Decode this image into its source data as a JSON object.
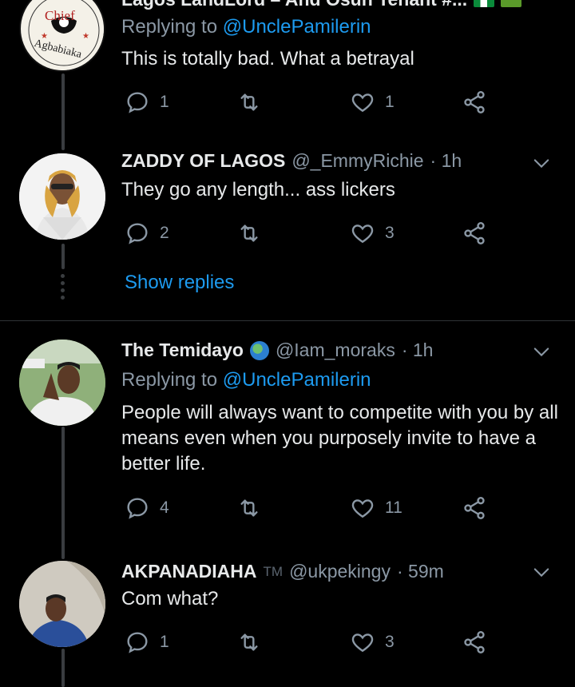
{
  "tweets": [
    {
      "name": "Lagos LandLord – And Osun Tenant #...",
      "reply_prefix": "Replying to ",
      "reply_handle": "@UnclePamilerin",
      "text": "This is totally bad. What a betrayal",
      "replies": "1",
      "likes": "1",
      "avatar_badge": {
        "line1": "Chief",
        "line2": "Agbabiaka"
      }
    },
    {
      "name": "ZADDY OF LAGOS",
      "handle": "@_EmmyRichie",
      "time": "· 1h",
      "text": "They go any length...  ass lickers",
      "replies": "2",
      "likes": "3"
    },
    {
      "name": "The Temidayo",
      "handle": "@Iam_moraks",
      "time": "· 1h",
      "reply_prefix": "Replying to ",
      "reply_handle": "@UnclePamilerin",
      "text": "People will always want to competite with you by all means even when you purposely invite to have a better life.",
      "replies": "4",
      "likes": "11"
    },
    {
      "name": "AKPANADIAHA",
      "tm": "TM",
      "handle": "@ukpekingy",
      "time": "· 59m",
      "text": "Com what?",
      "replies": "1",
      "likes": "3"
    }
  ],
  "show_replies": "Show replies",
  "icons": [
    "reply-icon",
    "retweet-icon",
    "like-icon",
    "share-icon",
    "chevron-down-icon",
    "globe-emoji-icon",
    "flag-icon"
  ],
  "colors": {
    "background": "#000000",
    "link": "#1d9bf0",
    "muted": "#8b98a5",
    "text": "#e7e9ea"
  }
}
